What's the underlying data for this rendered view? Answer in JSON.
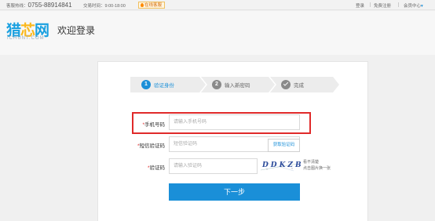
{
  "topbar": {
    "hotline_label": "客服热线：",
    "hotline_number": "0755-88914841",
    "hours": "交易时间：9:00-18:00",
    "chat": "在线客服",
    "login": "登录",
    "register": "免费注册",
    "member_center": "会员中心",
    "member_arrow": "▾"
  },
  "header": {
    "logo_cn_1": "猎",
    "logo_cn_2": "芯",
    "logo_cn_3": "网",
    "logo_en": "ICHUNT.COM",
    "title": "欢迎登录"
  },
  "steps": [
    {
      "num": "1",
      "label": "验证身份",
      "active": true
    },
    {
      "num": "2",
      "label": "输入新密码",
      "active": false
    },
    {
      "num": "",
      "label": "完成",
      "active": false,
      "icon": "check-circle-icon"
    }
  ],
  "form": {
    "phone_label": "手机号码",
    "phone_placeholder": "请输入手机号码",
    "sms_label": "短信验证码",
    "sms_placeholder": "短信验证码",
    "sms_button": "获取验证码",
    "captcha_label": "验证码",
    "captcha_placeholder": "请输入验证码",
    "captcha_code": "DDKZB",
    "captcha_hint_1": "看不清楚",
    "captcha_hint_2": "点击图片换一张",
    "next_button": "下一步",
    "required_mark": "*"
  },
  "colors": {
    "accent": "#1a8fd8",
    "highlight": "#e02a2a",
    "logo_blue": "#1aa0e0",
    "logo_orange": "#fbb81c"
  }
}
